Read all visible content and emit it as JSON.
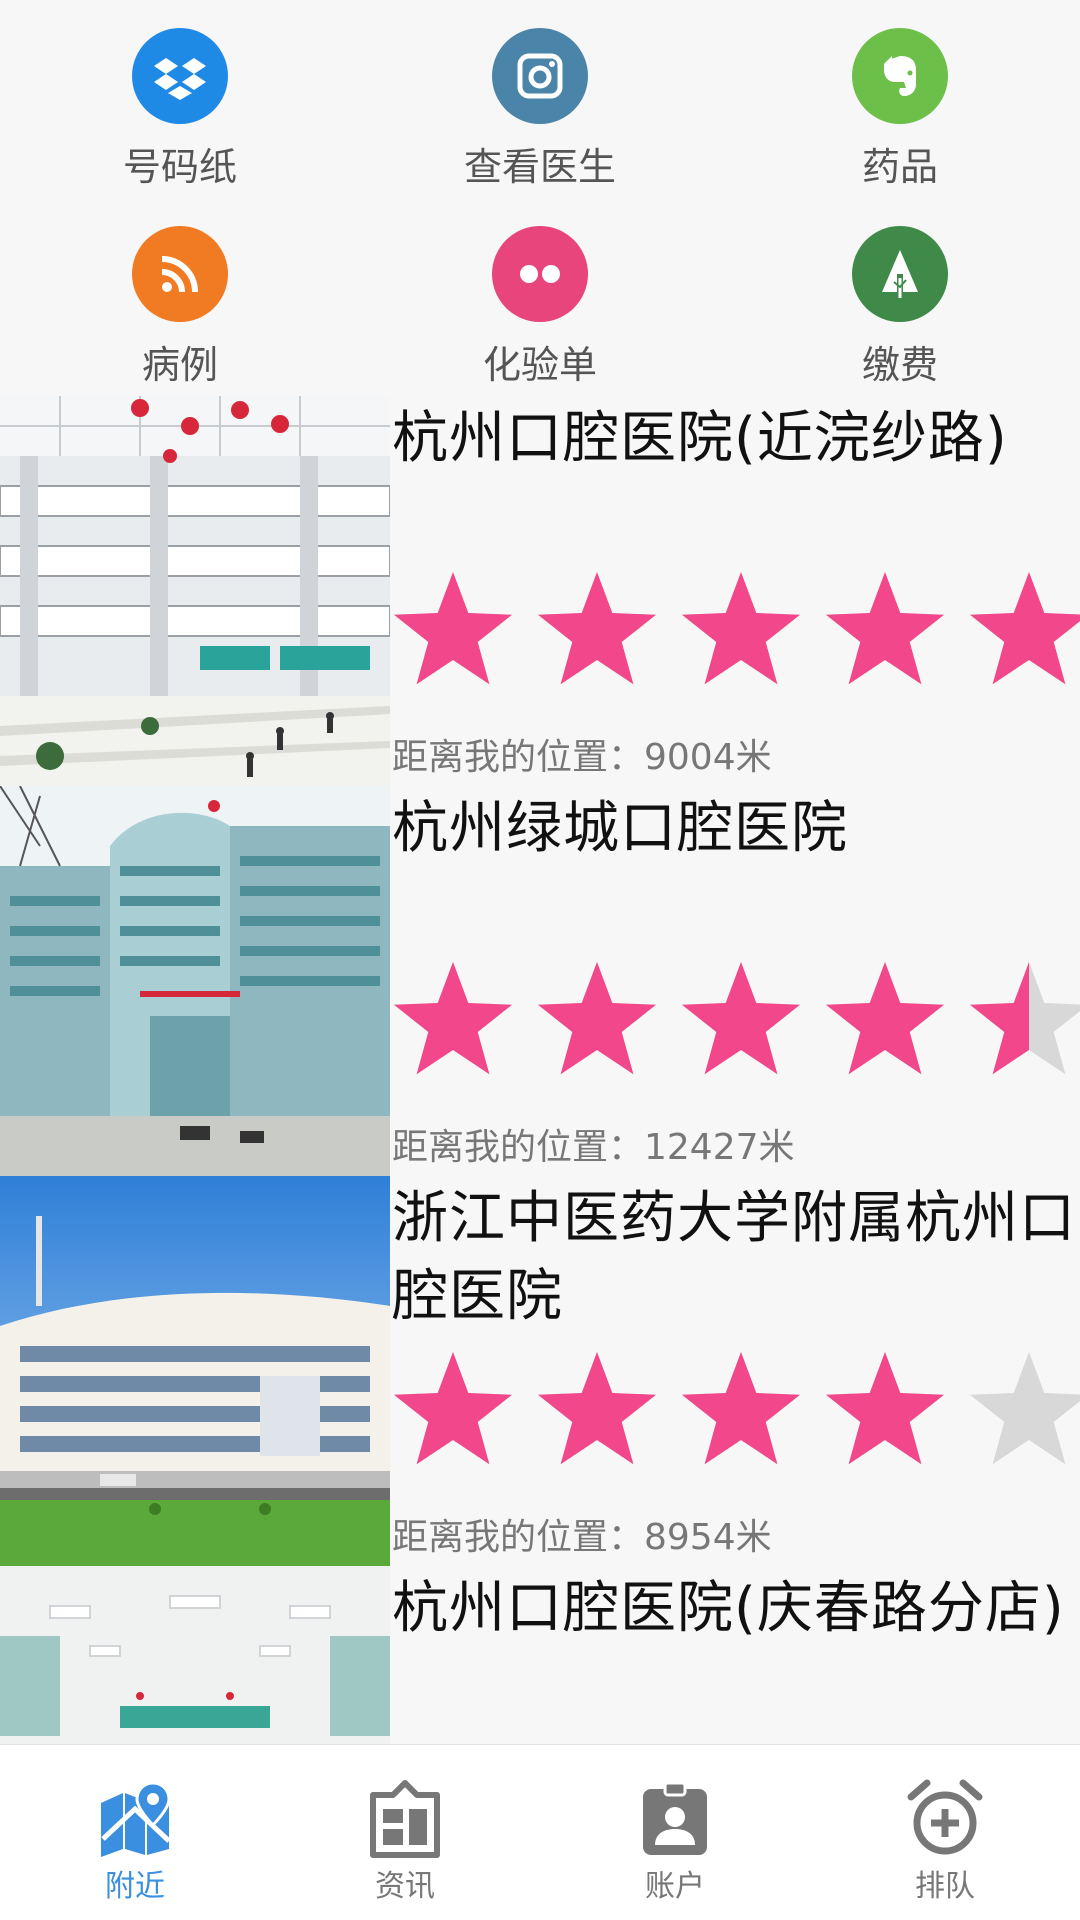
{
  "grid": {
    "items": [
      {
        "label": "号码纸",
        "icon": "dropbox-icon",
        "color": "#1f8ae6"
      },
      {
        "label": "查看医生",
        "icon": "instagram-icon",
        "color": "#4a84a8"
      },
      {
        "label": "药品",
        "icon": "evernote-icon",
        "color": "#6cc04a"
      },
      {
        "label": "病例",
        "icon": "rss-icon",
        "color": "#f07b22"
      },
      {
        "label": "化验单",
        "icon": "flickr-icon",
        "color": "#e8457c"
      },
      {
        "label": "缴费",
        "icon": "tree-icon",
        "color": "#3f8a48"
      }
    ]
  },
  "list": {
    "hospitals": [
      {
        "name": "杭州口腔医院(近浣纱路)",
        "rating": 5,
        "distance": "距离我的位置：9004米",
        "image": "atrium-photo"
      },
      {
        "name": "杭州绿城口腔医院",
        "rating": 4.5,
        "distance": "距离我的位置：12427米",
        "image": "building-photo"
      },
      {
        "name": "浙江中医药大学附属杭州口腔医院",
        "rating": 4,
        "distance": "距离我的位置：8954米",
        "image": "exterior-photo"
      },
      {
        "name": "杭州口腔医院(庆春路分店)",
        "rating": null,
        "distance": "",
        "image": "corridor-photo"
      }
    ]
  },
  "tabbar": {
    "items": [
      {
        "label": "附近",
        "icon": "map-pin-icon",
        "active": true
      },
      {
        "label": "资讯",
        "icon": "news-icon",
        "active": false
      },
      {
        "label": "账户",
        "icon": "account-badge-icon",
        "active": false
      },
      {
        "label": "排队",
        "icon": "alarm-add-icon",
        "active": false
      }
    ],
    "active_color": "#3a8fe0",
    "inactive_color": "#777777"
  },
  "colors": {
    "star_filled": "#f2478a",
    "star_empty": "#d8d8d8",
    "background": "#f7f7f7"
  }
}
